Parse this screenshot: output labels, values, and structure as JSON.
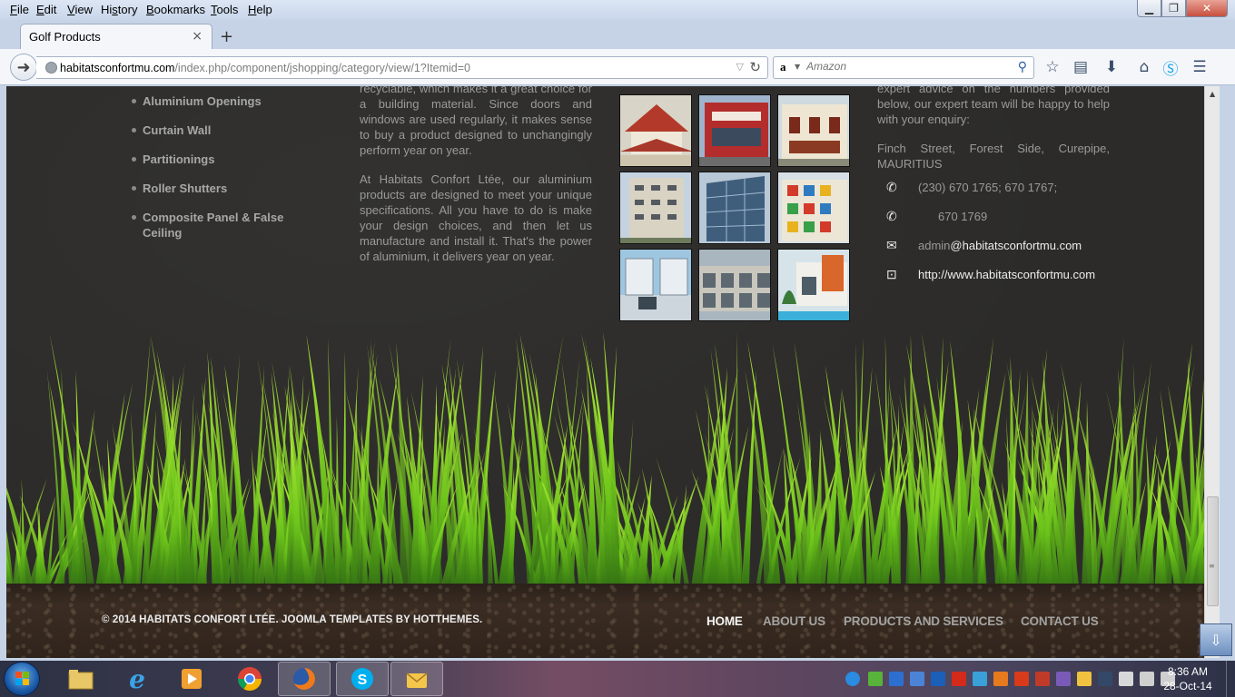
{
  "menubar": {
    "items": [
      {
        "pre": "",
        "ul": "F",
        "post": "ile"
      },
      {
        "pre": "",
        "ul": "E",
        "post": "dit"
      },
      {
        "pre": "",
        "ul": "V",
        "post": "iew"
      },
      {
        "pre": "Hi",
        "ul": "s",
        "post": "tory"
      },
      {
        "pre": "",
        "ul": "B",
        "post": "ookmarks"
      },
      {
        "pre": "",
        "ul": "T",
        "post": "ools"
      },
      {
        "pre": "",
        "ul": "H",
        "post": "elp"
      }
    ]
  },
  "tab": {
    "title": "Golf Products",
    "close": "×",
    "new": "+"
  },
  "url": {
    "host": "habitatsconfortmu.com",
    "path": "/index.php/component/jshopping/category/view/1?Itemid=0"
  },
  "search": {
    "engine": "a",
    "placeholder": "Amazon"
  },
  "products": [
    "Aluminium Openings",
    "Curtain Wall",
    "Partitionings",
    "Roller Shutters",
    "Composite Panel & False Ceiling"
  ],
  "about": {
    "p1": "recyclable, which makes it a great choice for a building material. Since doors and windows are used regularly, it makes sense to buy a product designed to unchangingly perform year on year.",
    "p2": "At Habitats Confort Ltée, our aluminium products are designed to meet your unique specifications. All you have to do is make your design choices, and then let us manufacture and install it. That's the power of aluminium, it delivers year on year."
  },
  "contact": {
    "intro": "expert advice on the numbers provided below, our expert team will be happy to help with your enquiry:",
    "address": "Finch Street, Forest Side, Curepipe, MAURITIUS",
    "phone1": "(230) 670 1765; 670 1767;",
    "phone2": "670 1769",
    "email_user": "admin",
    "email_domain": "@habitatsconfortmu.com",
    "website": "http://www.habitatsconfortmu.com"
  },
  "footer": {
    "copyright": "© 2014 HABITATS CONFORT LTÉE. JOOMLA TEMPLATES BY HOTTHEMES.",
    "nav": [
      {
        "label": "HOME",
        "active": true
      },
      {
        "label": "ABOUT US",
        "active": false
      },
      {
        "label": "PRODUCTS AND SERVICES",
        "active": false
      },
      {
        "label": "CONTACT US",
        "active": false
      }
    ]
  },
  "taskbar": {
    "apps": [
      "file-explorer",
      "internet-explorer",
      "media-player",
      "chrome",
      "firefox",
      "skype",
      "outlook"
    ],
    "time": "8:36 AM",
    "date": "28-Oct-14"
  },
  "colors": {
    "page_bg": "#2c2b29",
    "grass": "#7bd21e",
    "text_muted": "#9a9a9a"
  }
}
